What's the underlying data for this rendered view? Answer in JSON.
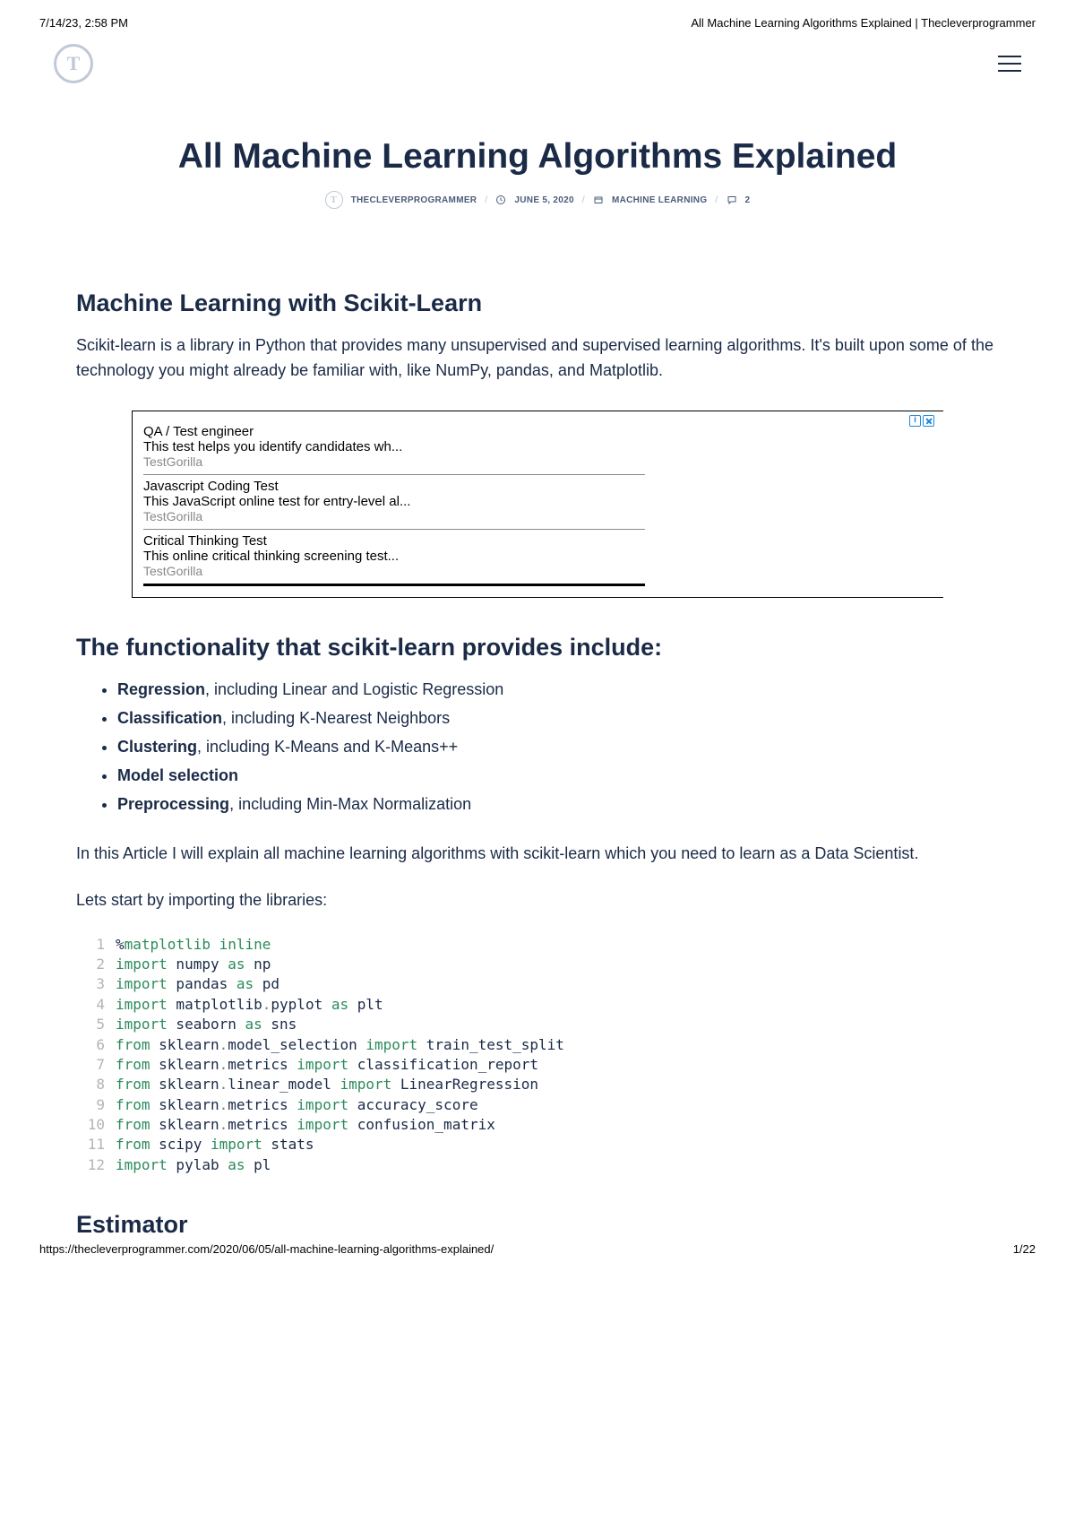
{
  "print": {
    "datetime": "7/14/23, 2:58 PM",
    "doc_title": "All Machine Learning Algorithms Explained | Thecleverprogrammer",
    "url": "https://thecleverprogrammer.com/2020/06/05/all-machine-learning-algorithms-explained/",
    "page": "1/22"
  },
  "nav": {
    "logo_letter": "T"
  },
  "article": {
    "title": "All Machine Learning Algorithms Explained",
    "author": "THECLEVERPROGRAMMER",
    "date": "JUNE 5, 2020",
    "category": "MACHINE LEARNING",
    "comments": "2"
  },
  "sections": {
    "h1": "Machine Learning with Scikit-Learn",
    "p1": "Scikit-learn is a library in Python that provides many unsupervised and supervised learning algorithms. It's built upon some of the technology you might already be familiar with, like NumPy, pandas, and Matplotlib.",
    "h2": "The functionality that scikit-learn provides include:",
    "features": [
      {
        "strong": "Regression",
        "rest": ", including Linear and Logistic Regression"
      },
      {
        "strong": "Classification",
        "rest": ", including K-Nearest Neighbors"
      },
      {
        "strong": "Clustering",
        "rest": ", including K-Means and K-Means++"
      },
      {
        "strong": "Model selection",
        "rest": ""
      },
      {
        "strong": "Preprocessing",
        "rest": ", including Min-Max Normalization"
      }
    ],
    "p2": "In this Article I will explain all machine learning algorithms with scikit-learn which you need to learn as a Data Scientist.",
    "p3": "Lets start by importing the libraries:",
    "h3": "Estimator"
  },
  "ads": [
    {
      "title": "QA / Test engineer",
      "desc": "This test helps you identify candidates wh...",
      "sponsor": "TestGorilla"
    },
    {
      "title": "Javascript Coding Test",
      "desc": "This JavaScript online test for entry-level al...",
      "sponsor": "TestGorilla"
    },
    {
      "title": "Critical Thinking Test",
      "desc": "This online critical thinking screening test...",
      "sponsor": "TestGorilla"
    }
  ],
  "code": [
    [
      {
        "t": "%",
        "c": "mod"
      },
      {
        "t": "matplotlib inline",
        "c": "kw"
      }
    ],
    [
      {
        "t": "import",
        "c": "kw"
      },
      {
        "t": " numpy ",
        "c": "mod"
      },
      {
        "t": "as",
        "c": "kw"
      },
      {
        "t": " np",
        "c": "mod"
      }
    ],
    [
      {
        "t": "import",
        "c": "kw"
      },
      {
        "t": " pandas ",
        "c": "mod"
      },
      {
        "t": "as",
        "c": "kw"
      },
      {
        "t": " pd",
        "c": "mod"
      }
    ],
    [
      {
        "t": "import",
        "c": "kw"
      },
      {
        "t": " matplotlib",
        "c": "mod"
      },
      {
        "t": ".",
        "c": "dot"
      },
      {
        "t": "pyplot ",
        "c": "mod"
      },
      {
        "t": "as",
        "c": "kw"
      },
      {
        "t": " plt",
        "c": "mod"
      }
    ],
    [
      {
        "t": "import",
        "c": "kw"
      },
      {
        "t": " seaborn ",
        "c": "mod"
      },
      {
        "t": "as",
        "c": "kw"
      },
      {
        "t": " sns",
        "c": "mod"
      }
    ],
    [
      {
        "t": "from",
        "c": "kw"
      },
      {
        "t": " sklearn",
        "c": "mod"
      },
      {
        "t": ".",
        "c": "dot"
      },
      {
        "t": "model_selection ",
        "c": "mod"
      },
      {
        "t": "import",
        "c": "kw"
      },
      {
        "t": " train_test_split",
        "c": "mod"
      }
    ],
    [
      {
        "t": "from",
        "c": "kw"
      },
      {
        "t": " sklearn",
        "c": "mod"
      },
      {
        "t": ".",
        "c": "dot"
      },
      {
        "t": "metrics ",
        "c": "mod"
      },
      {
        "t": "import",
        "c": "kw"
      },
      {
        "t": " classification_report",
        "c": "mod"
      }
    ],
    [
      {
        "t": "from",
        "c": "kw"
      },
      {
        "t": " sklearn",
        "c": "mod"
      },
      {
        "t": ".",
        "c": "dot"
      },
      {
        "t": "linear_model ",
        "c": "mod"
      },
      {
        "t": "import",
        "c": "kw"
      },
      {
        "t": " LinearRegression",
        "c": "mod"
      }
    ],
    [
      {
        "t": "from",
        "c": "kw"
      },
      {
        "t": " sklearn",
        "c": "mod"
      },
      {
        "t": ".",
        "c": "dot"
      },
      {
        "t": "metrics ",
        "c": "mod"
      },
      {
        "t": "import",
        "c": "kw"
      },
      {
        "t": " accuracy_score",
        "c": "mod"
      }
    ],
    [
      {
        "t": "from",
        "c": "kw"
      },
      {
        "t": " sklearn",
        "c": "mod"
      },
      {
        "t": ".",
        "c": "dot"
      },
      {
        "t": "metrics ",
        "c": "mod"
      },
      {
        "t": "import",
        "c": "kw"
      },
      {
        "t": " confusion_matrix",
        "c": "mod"
      }
    ],
    [
      {
        "t": "from",
        "c": "kw"
      },
      {
        "t": " scipy ",
        "c": "mod"
      },
      {
        "t": "import",
        "c": "kw"
      },
      {
        "t": " stats",
        "c": "mod"
      }
    ],
    [
      {
        "t": "import",
        "c": "kw"
      },
      {
        "t": " pylab ",
        "c": "mod"
      },
      {
        "t": "as",
        "c": "kw"
      },
      {
        "t": " pl",
        "c": "mod"
      }
    ]
  ]
}
